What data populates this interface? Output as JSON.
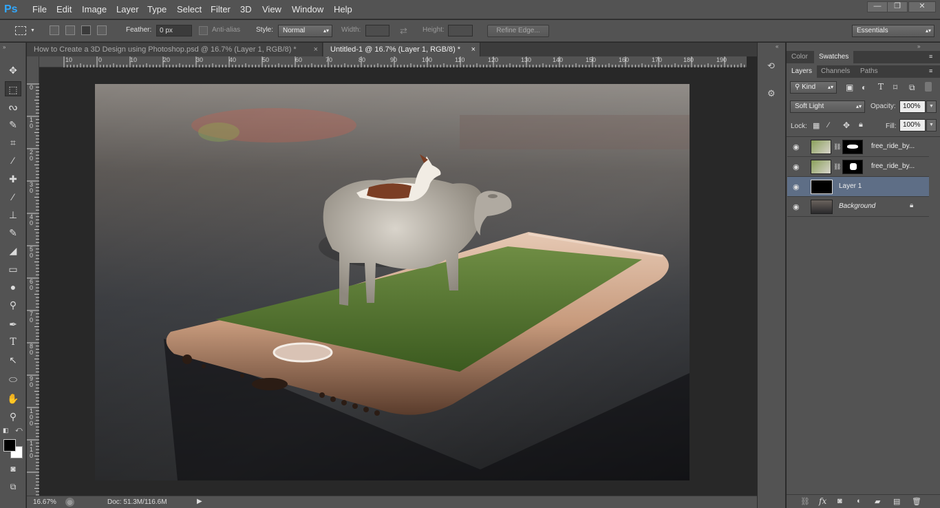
{
  "app": {
    "logo": "Ps"
  },
  "menu": [
    "File",
    "Edit",
    "Image",
    "Layer",
    "Type",
    "Select",
    "Filter",
    "3D",
    "View",
    "Window",
    "Help"
  ],
  "window_controls": {
    "minimize": "—",
    "restore": "❐",
    "close": "✕"
  },
  "options": {
    "feather_label": "Feather:",
    "feather_value": "0 px",
    "antialias_label": "Anti-alias",
    "style_label": "Style:",
    "style_value": "Normal",
    "width_label": "Width:",
    "height_label": "Height:",
    "refine_edge": "Refine Edge...",
    "workspace": "Essentials"
  },
  "tabs": [
    {
      "title": "How to Create a 3D Design using Photoshop.psd @ 16.7% (Layer 1, RGB/8) *",
      "close": "×"
    },
    {
      "title": "Untitled-1 @ 16.7% (Layer 1, RGB/8) *",
      "close": "×"
    }
  ],
  "ruler_h": [
    "10",
    "0",
    "10",
    "20",
    "30",
    "40",
    "50",
    "60",
    "70",
    "80",
    "90",
    "100",
    "110",
    "120",
    "130",
    "140",
    "150",
    "160",
    "170",
    "180",
    "190"
  ],
  "ruler_v": [
    "0",
    "1\n0",
    "2\n0",
    "3\n0",
    "4\n0",
    "5\n0",
    "6\n0",
    "7\n0",
    "8\n0",
    "9\n0",
    "1\n0\n0",
    "1\n1\n0"
  ],
  "status": {
    "zoom": "16.67%",
    "doc": "Doc: 51.3M/116.6M"
  },
  "panels": {
    "top_tabs": [
      "Color",
      "Swatches"
    ],
    "layer_tabs": [
      "Layers",
      "Channels",
      "Paths"
    ],
    "filter_kind": "Kind",
    "blend_mode": "Soft Light",
    "opacity_label": "Opacity:",
    "opacity_value": "100%",
    "lock_label": "Lock:",
    "fill_label": "Fill:",
    "fill_value": "100%"
  },
  "layers": [
    {
      "name": "free_ride_by...",
      "selected": false
    },
    {
      "name": "free_ride_by...",
      "selected": false
    },
    {
      "name": "Layer 1",
      "selected": true
    },
    {
      "name": "Background",
      "selected": false
    }
  ],
  "colors": {
    "accent": "#31a8ff",
    "panel": "#535353",
    "selected_layer": "#5e6e86"
  }
}
